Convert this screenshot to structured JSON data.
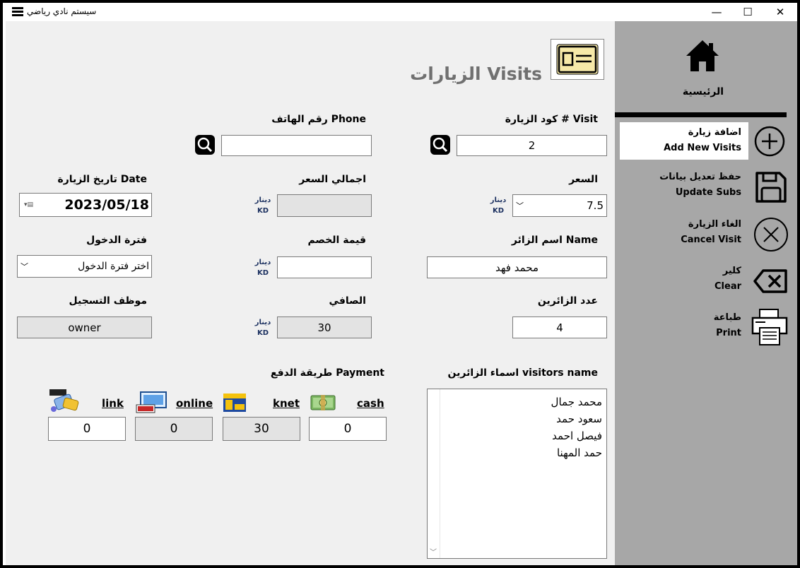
{
  "window": {
    "title": "سيستم نادي رياضي",
    "min": "—",
    "max": "☐",
    "close": "✕"
  },
  "header": {
    "title": "الزيارات Visits"
  },
  "labels": {
    "visit_code": "كود الزيارة # Visit",
    "phone": "رقم الهاتف  Phone",
    "price": "السعر",
    "total_price": "اجمالي السعر",
    "visit_date": "تاريخ الزيارة Date",
    "visitor_name": "اسم الزائر Name",
    "discount": "قيمة الخصم",
    "entry_period": "فترة الدخول",
    "visitor_count": "عدد الزائرين",
    "net": "الصافي",
    "reg_employee": "موظف التسجيل",
    "visitors_names": "اسماء الزائرين visitors name",
    "payment": "طريقة الدفع Payment",
    "currency_ar": "دينار",
    "currency_en": "KD"
  },
  "values": {
    "visit_code": "2",
    "phone": "",
    "price": "7.5",
    "total_price": "",
    "visit_date": "2023/05/18",
    "visitor_name": "محمد فهد",
    "discount": "",
    "entry_period": "اختر فترة الدخول",
    "visitor_count": "4",
    "net": "30",
    "reg_employee": "owner",
    "visitors_list": [
      "محمد جمال",
      "سعود حمد",
      "فيصل احمد",
      "حمد المهنا"
    ]
  },
  "payment": {
    "cash": {
      "label": "cash",
      "value": "0"
    },
    "knet": {
      "label": "knet",
      "value": "30"
    },
    "online": {
      "label": "online",
      "value": "0"
    },
    "link": {
      "label": "link",
      "value": "0"
    }
  },
  "sidebar": {
    "home": "الرئيسية",
    "add_ar": "اضافة زيارة",
    "add_en": "Add New Visits",
    "save_ar": "حفظ تعديل بيانات",
    "save_en": "Update Subs",
    "cancel_ar": "الغاء الزيارة",
    "cancel_en": "Cancel Visit",
    "clear_ar": "كلير",
    "clear_en": "Clear",
    "print_ar": "طباعة",
    "print_en": "Print"
  }
}
